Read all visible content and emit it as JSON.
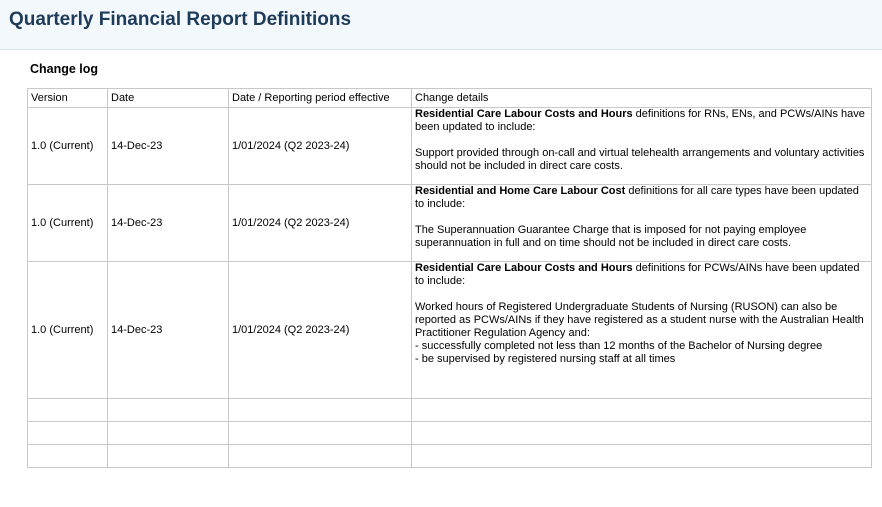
{
  "page": {
    "title": "Quarterly Financial Report Definitions"
  },
  "changelog": {
    "heading": "Change log",
    "columns": [
      "Version",
      "Date",
      "Date / Reporting period effective",
      "Change details"
    ],
    "rows": [
      {
        "version": "1.0 (Current)",
        "date": "14-Dec-23",
        "effective": "1/01/2024 (Q2 2023-24)",
        "details_bold": "Residential Care Labour Costs and Hours",
        "details_rest": " definitions for RNs, ENs, and PCWs/AINs have been updated to include:",
        "details_body": "Support provided through on-call and virtual telehealth arrangements and voluntary activities should not be included in direct care costs."
      },
      {
        "version": "1.0 (Current)",
        "date": "14-Dec-23",
        "effective": "1/01/2024 (Q2 2023-24)",
        "details_bold": "Residential and Home Care Labour Cost",
        "details_rest": " definitions for all care types have been updated to include:",
        "details_body": "The Superannuation Guarantee Charge that is imposed for not paying employee superannuation in full and on time should not be included in direct care costs."
      },
      {
        "version": "1.0 (Current)",
        "date": "14-Dec-23",
        "effective": "1/01/2024 (Q2 2023-24)",
        "details_bold": "Residential Care Labour Costs and Hours",
        "details_rest": " definitions for PCWs/AINs have been updated to include:",
        "details_body": "Worked hours of Registered Undergraduate Students of Nursing (RUSON) can also be reported as PCWs/AINs if they have registered as a student nurse with the Australian Health Practitioner Regulation Agency and:",
        "details_bullets": [
          "- successfully completed not less than 12 months of the Bachelor of Nursing degree",
          "- be supervised by registered nursing staff at all times"
        ]
      }
    ]
  }
}
